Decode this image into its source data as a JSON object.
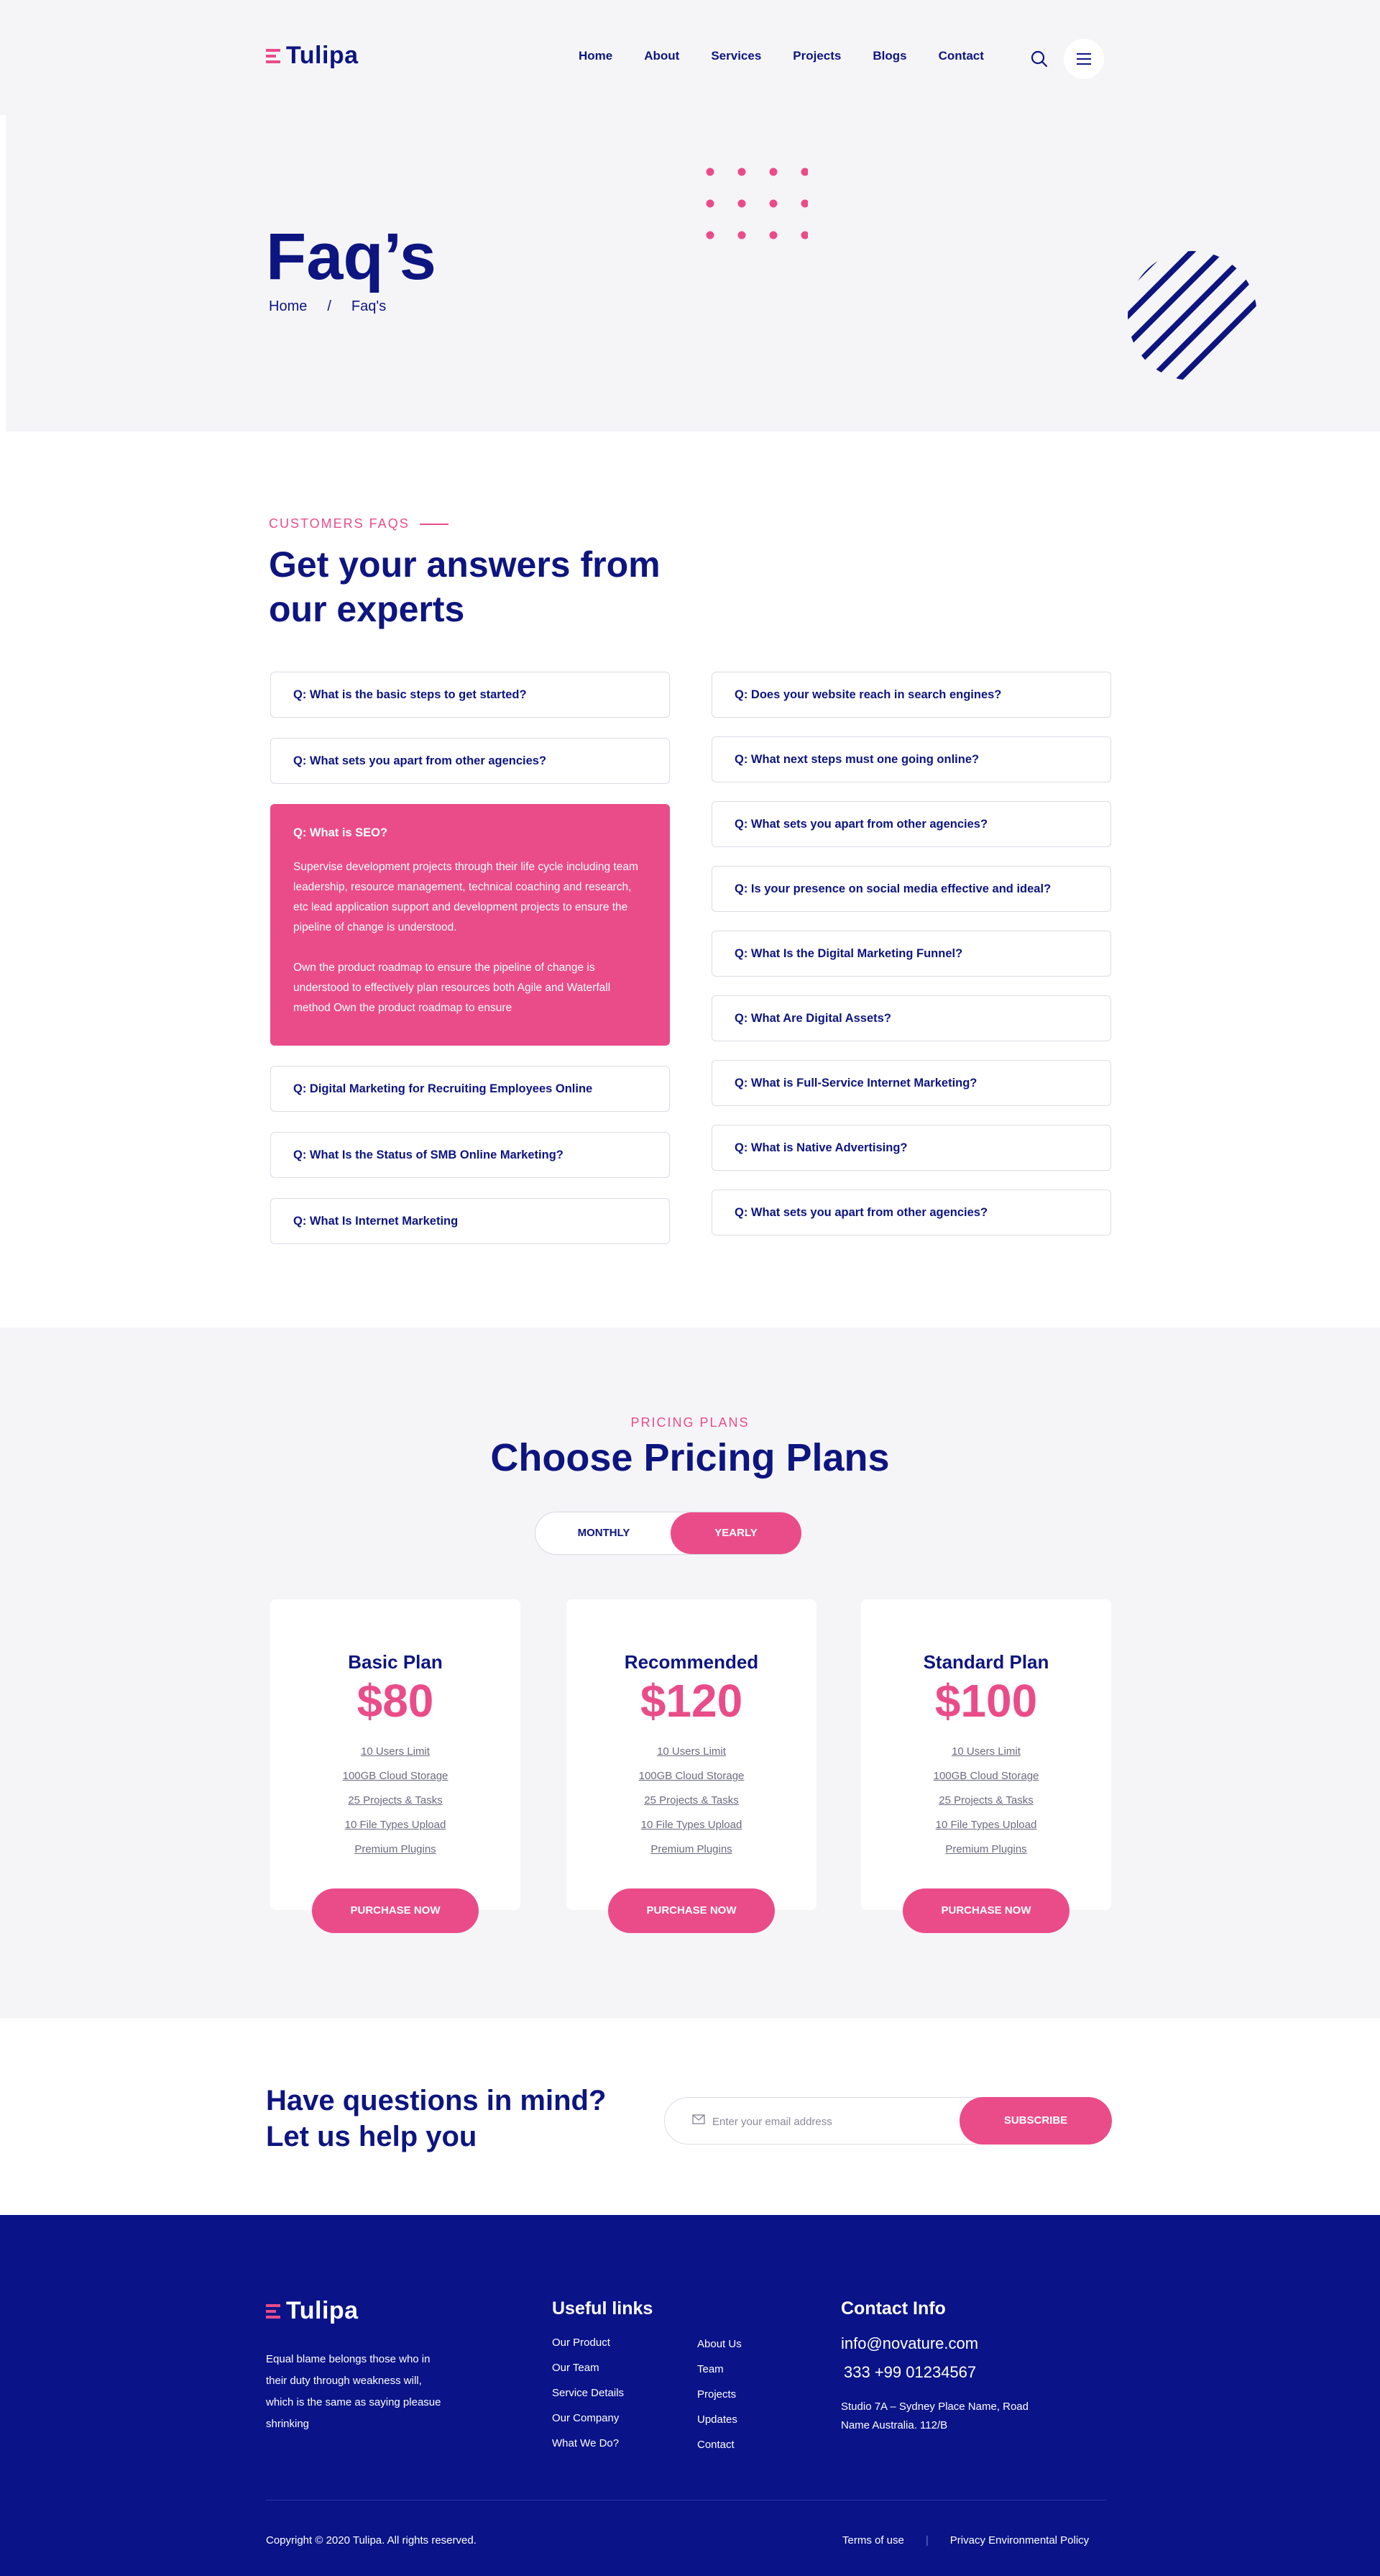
{
  "brand": {
    "name": "Tulipa",
    "accent": "#ea4c89",
    "navy": "#0d1580",
    "footer_bg": "#0a1488"
  },
  "nav": {
    "items": [
      "Home",
      "About",
      "Services",
      "Projects",
      "Blogs",
      "Contact"
    ],
    "search_icon": "search-icon",
    "menu_icon": "hamburger-icon"
  },
  "banner": {
    "title": "Faq’s",
    "breadcrumb": {
      "home": "Home",
      "separator": "/",
      "current": "Faq's"
    }
  },
  "faq": {
    "eyebrow": "CUSTOMERS FAQS",
    "heading": "Get your answers from our experts",
    "left": [
      {
        "q": "Q: What is the basic steps to get started?"
      },
      {
        "q": "Q: What sets you apart from other agencies?"
      },
      {
        "q": "Q: What is SEO?",
        "open": true,
        "answer_1": "Supervise development projects through their life cycle including team leadership, resource management, technical coaching and research, etc lead application support and development projects to ensure the pipeline of change is understood.",
        "answer_2": "Own the product roadmap to ensure the pipeline of change is understood to effectively plan resources both Agile and Waterfall method Own the product roadmap to ensure"
      },
      {
        "q": "Q: Digital Marketing for Recruiting Employees Online"
      },
      {
        "q": "Q: What Is the Status of SMB Online Marketing?"
      },
      {
        "q": "Q: What Is Internet Marketing"
      }
    ],
    "right": [
      {
        "q": "Q: Does your website reach in search engines?"
      },
      {
        "q": "Q: What next steps must one going online?"
      },
      {
        "q": "Q: What sets you apart from other agencies?"
      },
      {
        "q": "Q: Is your presence on social media effective and ideal?"
      },
      {
        "q": "Q: What Is the Digital Marketing Funnel?"
      },
      {
        "q": "Q: What Are Digital Assets?"
      },
      {
        "q": "Q: What is Full-Service Internet Marketing?"
      },
      {
        "q": "Q: What is Native Advertising?"
      },
      {
        "q": "Q: What sets you apart from other agencies?"
      }
    ]
  },
  "pricing": {
    "eyebrow": "PRICING PLANS",
    "title": "Choose Pricing Plans",
    "toggle": {
      "monthly": "MONTHLY",
      "yearly": "YEARLY",
      "active": "yearly"
    },
    "plans": [
      {
        "name": "Basic Plan",
        "price": "$80",
        "features": [
          "10 Users Limit",
          "100GB Cloud Storage",
          "25 Projects & Tasks",
          "10 File Types Upload",
          "Premium Plugins"
        ],
        "cta": "PURCHASE NOW"
      },
      {
        "name": "Recommended",
        "price": "$120",
        "features": [
          "10 Users Limit",
          "100GB Cloud Storage",
          "25 Projects & Tasks",
          "10 File Types Upload",
          "Premium Plugins"
        ],
        "cta": "PURCHASE NOW"
      },
      {
        "name": "Standard Plan",
        "price": "$100",
        "features": [
          "10 Users Limit",
          "100GB Cloud Storage",
          "25 Projects & Tasks",
          "10 File Types Upload",
          "Premium Plugins"
        ],
        "cta": "PURCHASE NOW"
      }
    ]
  },
  "subscribe": {
    "heading_line1": "Have questions in mind?",
    "heading_line2": "Let us help you",
    "placeholder": "Enter your email address",
    "button": "SUBSCRIBE"
  },
  "footer": {
    "description": "Equal blame belongs those who in their duty through weakness will, which is the same as saying pleasue shrinking",
    "useful_links_title": "Useful links",
    "links_col1": [
      "Our Product",
      "Our Team",
      "Service Details",
      "Our Company",
      "What We Do?"
    ],
    "links_col2": [
      "About Us",
      "Team",
      "Projects",
      "Updates",
      "Contact"
    ],
    "contact_title": "Contact Info",
    "email": "info@novature.com",
    "phone": "333 +99 01234567",
    "address": "Studio 7A – Sydney Place Name, Road Name Australia. 112/B",
    "copyright": "Copyright © 2020 Tulipa. All rights reserved.",
    "terms": "Terms of use",
    "separator": "|",
    "privacy": "Privacy Environmental Policy"
  }
}
